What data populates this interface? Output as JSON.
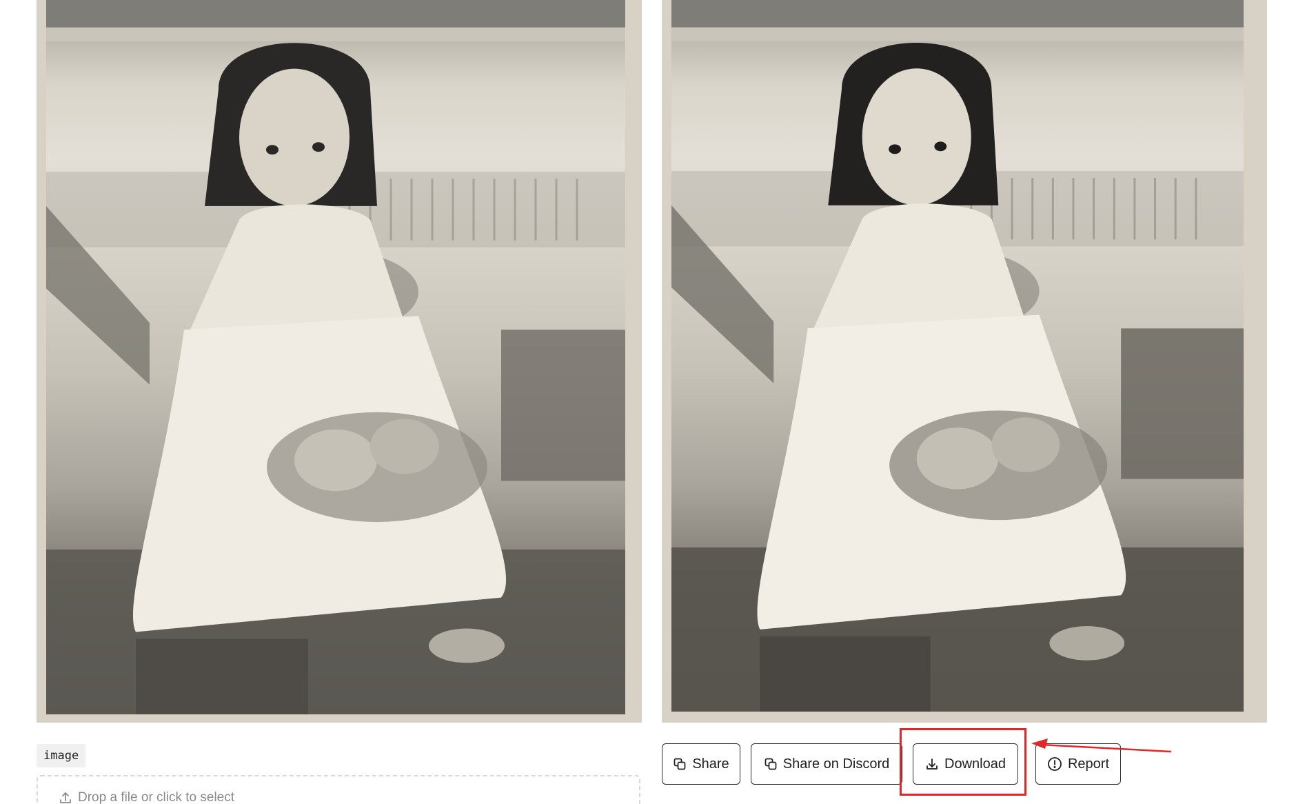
{
  "input": {
    "tag_label": "image",
    "drop_zone_text": "Drop a file or click to select"
  },
  "output": {
    "buttons": {
      "share": "Share",
      "share_discord": "Share on Discord",
      "download": "Download",
      "report": "Report"
    }
  },
  "annotation": {
    "highlight_color": "#e3262a"
  }
}
